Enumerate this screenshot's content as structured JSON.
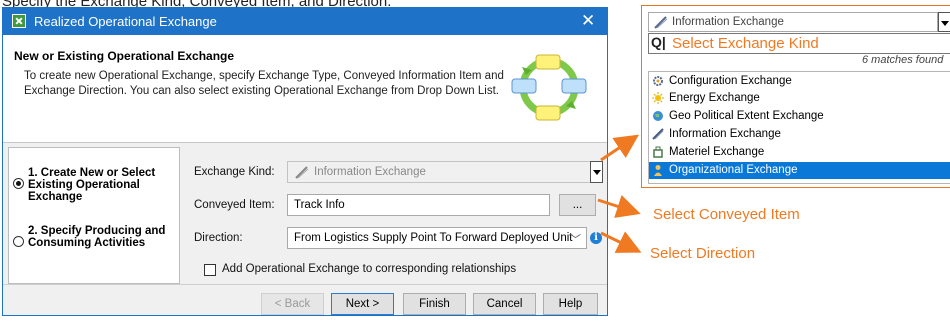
{
  "caption": "Specify the Exchange Kind, Conveyed Item, and Direction.",
  "dialog": {
    "title": "Realized Operational Exchange",
    "header_title": "New or Existing Operational Exchange",
    "header_desc": "To create new Operational Exchange, specify Exchange Type, Conveyed Information Item and Exchange Direction. You can also select existing Operational Exchange from Drop Down List.",
    "steps": [
      {
        "label": "1. Create New or Select Existing Operational Exchange",
        "checked": true
      },
      {
        "label": "2. Specify Producing and Consuming Activities",
        "checked": false
      }
    ],
    "fields": {
      "exchange_kind_label": "Exchange Kind:",
      "exchange_kind_value": "Information Exchange",
      "conveyed_item_label": "Conveyed Item:",
      "conveyed_item_value": "Track Info",
      "browse_label": "...",
      "direction_label": "Direction:",
      "direction_value": "From Logistics Supply Point To Forward Deployed Unit",
      "add_checkbox_label": "Add Operational Exchange to corresponding relationships"
    },
    "buttons": {
      "back": "< Back",
      "next": "Next >",
      "finish": "Finish",
      "cancel": "Cancel",
      "help": "Help"
    }
  },
  "dropdown": {
    "selected_value": "Information Exchange",
    "search_annotation": "Select Exchange Kind",
    "matches_text": "6 matches found",
    "items": [
      {
        "label": "Configuration Exchange",
        "icon": "configuration-exchange-icon",
        "selected": false
      },
      {
        "label": "Energy Exchange",
        "icon": "energy-exchange-icon",
        "selected": false
      },
      {
        "label": "Geo Political Extent Exchange",
        "icon": "geo-political-exchange-icon",
        "selected": false
      },
      {
        "label": "Information Exchange",
        "icon": "information-exchange-icon",
        "selected": false
      },
      {
        "label": "Materiel Exchange",
        "icon": "materiel-exchange-icon",
        "selected": false
      },
      {
        "label": "Organizational Exchange",
        "icon": "organizational-exchange-icon",
        "selected": true
      }
    ]
  },
  "annotations": {
    "conveyed_item": "Select Conveyed Item",
    "direction": "Select Direction"
  },
  "colors": {
    "accent_orange": "#f07a22",
    "titlebar_blue": "#1e73c8",
    "selection_blue": "#0a78d7"
  }
}
